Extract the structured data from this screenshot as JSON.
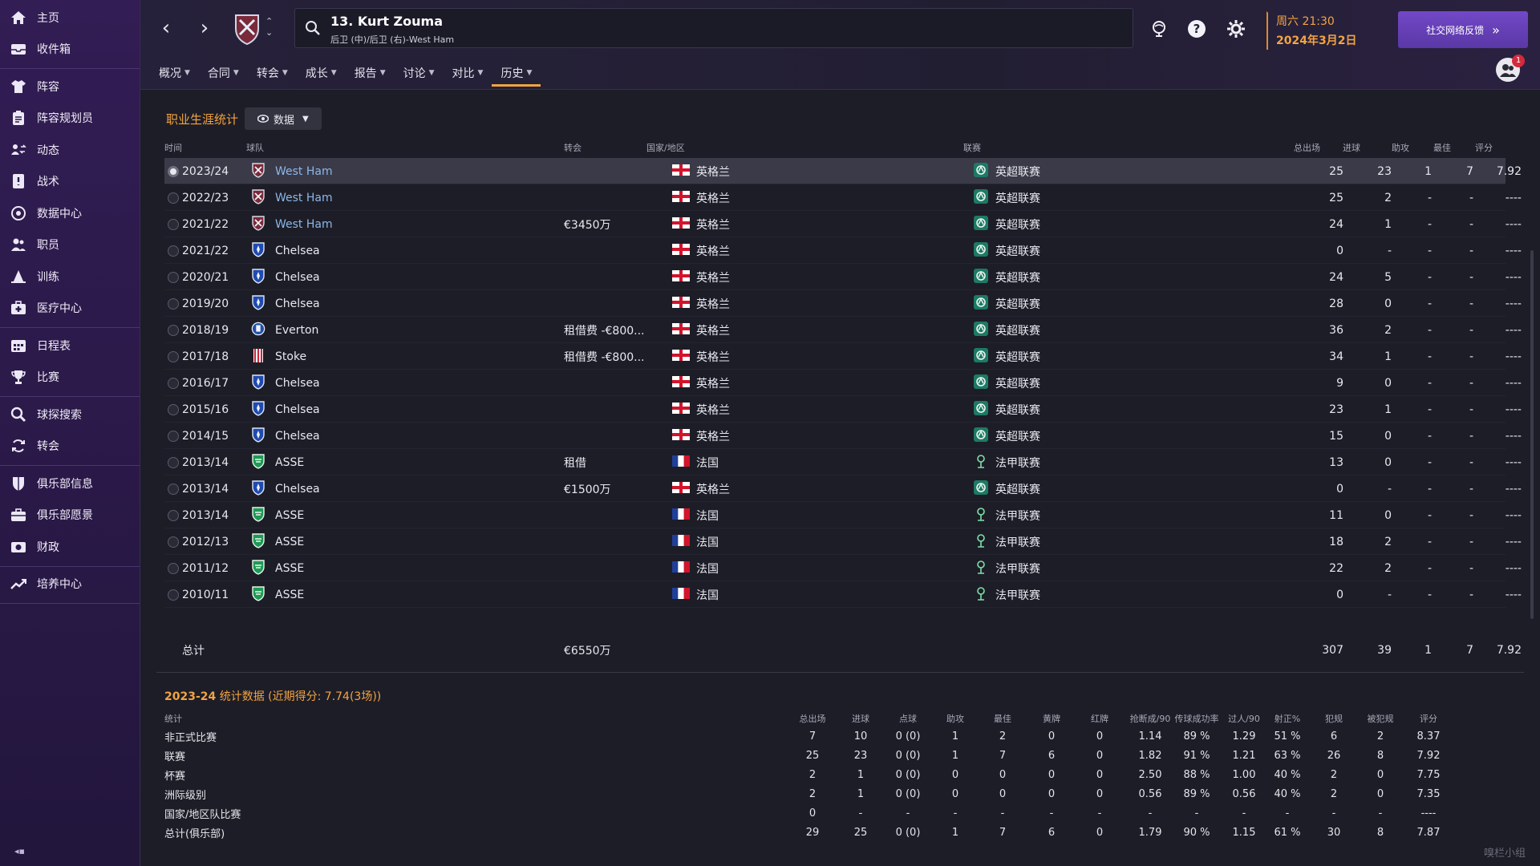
{
  "sidebar": {
    "groups": [
      [
        {
          "label": "主页",
          "icon": "home-icon"
        },
        {
          "label": "收件箱",
          "icon": "inbox-icon"
        }
      ],
      [
        {
          "label": "阵容",
          "icon": "shirt-icon"
        },
        {
          "label": "阵容规划员",
          "icon": "clipboard-icon"
        },
        {
          "label": "动态",
          "icon": "dynamics-icon"
        },
        {
          "label": "战术",
          "icon": "tactics-icon"
        },
        {
          "label": "数据中心",
          "icon": "data-hub-icon"
        },
        {
          "label": "职员",
          "icon": "staff-icon"
        },
        {
          "label": "训练",
          "icon": "training-icon"
        },
        {
          "label": "医疗中心",
          "icon": "medical-icon"
        }
      ],
      [
        {
          "label": "日程表",
          "icon": "calendar-icon"
        },
        {
          "label": "比赛",
          "icon": "trophy-icon"
        }
      ],
      [
        {
          "label": "球探搜索",
          "icon": "scout-search-icon"
        },
        {
          "label": "转会",
          "icon": "transfer-icon"
        }
      ],
      [
        {
          "label": "俱乐部信息",
          "icon": "club-shield-icon"
        },
        {
          "label": "俱乐部愿景",
          "icon": "briefcase-icon"
        },
        {
          "label": "财政",
          "icon": "finance-icon"
        }
      ],
      [
        {
          "label": "培养中心",
          "icon": "development-icon"
        }
      ]
    ]
  },
  "header": {
    "player_name": "13. Kurt Zouma",
    "player_position": "后卫 (中)/后卫 (右)-West Ham",
    "date_time": "周六 21:30",
    "date": "2024年3月2日",
    "feedback_label": "社交网络反馈",
    "notification_count": "1",
    "tabs": [
      {
        "label": "概况",
        "active": false
      },
      {
        "label": "合同",
        "active": false
      },
      {
        "label": "转会",
        "active": false
      },
      {
        "label": "成长",
        "active": false
      },
      {
        "label": "报告",
        "active": false
      },
      {
        "label": "讨论",
        "active": false
      },
      {
        "label": "对比",
        "active": false
      },
      {
        "label": "历史",
        "active": true
      }
    ]
  },
  "career": {
    "title": "职业生涯统计",
    "dropdown_label": "数据",
    "columns": {
      "season": "时间",
      "team": "球队",
      "transfer": "转会",
      "nation": "国家/地区",
      "league": "联赛",
      "apps": "总出场",
      "goals": "进球",
      "assists": "助攻",
      "pom": "最佳",
      "rating": "评分"
    },
    "rows": [
      {
        "season": "2023/24",
        "team": "West Ham",
        "club": "westham",
        "transfer": "",
        "nation": "英格兰",
        "flag": "eng",
        "league": "英超联赛",
        "lg": "epl",
        "apps": "25",
        "goals": "23",
        "assists": "1",
        "pom": "7",
        "rating": "7.92",
        "selected": true
      },
      {
        "season": "2022/23",
        "team": "West Ham",
        "club": "westham",
        "transfer": "",
        "nation": "英格兰",
        "flag": "eng",
        "league": "英超联赛",
        "lg": "epl",
        "apps": "25",
        "goals": "2",
        "assists": "-",
        "pom": "-",
        "rating": "----"
      },
      {
        "season": "2021/22",
        "team": "West Ham",
        "club": "westham",
        "transfer": "€3450万",
        "nation": "英格兰",
        "flag": "eng",
        "league": "英超联赛",
        "lg": "epl",
        "apps": "24",
        "goals": "1",
        "assists": "-",
        "pom": "-",
        "rating": "----"
      },
      {
        "season": "2021/22",
        "team": "Chelsea",
        "club": "chelsea",
        "transfer": "",
        "nation": "英格兰",
        "flag": "eng",
        "league": "英超联赛",
        "lg": "epl",
        "apps": "0",
        "goals": "-",
        "assists": "-",
        "pom": "-",
        "rating": "----"
      },
      {
        "season": "2020/21",
        "team": "Chelsea",
        "club": "chelsea",
        "transfer": "",
        "nation": "英格兰",
        "flag": "eng",
        "league": "英超联赛",
        "lg": "epl",
        "apps": "24",
        "goals": "5",
        "assists": "-",
        "pom": "-",
        "rating": "----"
      },
      {
        "season": "2019/20",
        "team": "Chelsea",
        "club": "chelsea",
        "transfer": "",
        "nation": "英格兰",
        "flag": "eng",
        "league": "英超联赛",
        "lg": "epl",
        "apps": "28",
        "goals": "0",
        "assists": "-",
        "pom": "-",
        "rating": "----"
      },
      {
        "season": "2018/19",
        "team": "Everton",
        "club": "everton",
        "transfer": "租借费 -€800...",
        "nation": "英格兰",
        "flag": "eng",
        "league": "英超联赛",
        "lg": "epl",
        "apps": "36",
        "goals": "2",
        "assists": "-",
        "pom": "-",
        "rating": "----"
      },
      {
        "season": "2017/18",
        "team": "Stoke",
        "club": "stoke",
        "transfer": "租借费 -€800...",
        "nation": "英格兰",
        "flag": "eng",
        "league": "英超联赛",
        "lg": "epl",
        "apps": "34",
        "goals": "1",
        "assists": "-",
        "pom": "-",
        "rating": "----"
      },
      {
        "season": "2016/17",
        "team": "Chelsea",
        "club": "chelsea",
        "transfer": "",
        "nation": "英格兰",
        "flag": "eng",
        "league": "英超联赛",
        "lg": "epl",
        "apps": "9",
        "goals": "0",
        "assists": "-",
        "pom": "-",
        "rating": "----"
      },
      {
        "season": "2015/16",
        "team": "Chelsea",
        "club": "chelsea",
        "transfer": "",
        "nation": "英格兰",
        "flag": "eng",
        "league": "英超联赛",
        "lg": "epl",
        "apps": "23",
        "goals": "1",
        "assists": "-",
        "pom": "-",
        "rating": "----"
      },
      {
        "season": "2014/15",
        "team": "Chelsea",
        "club": "chelsea",
        "transfer": "",
        "nation": "英格兰",
        "flag": "eng",
        "league": "英超联赛",
        "lg": "epl",
        "apps": "15",
        "goals": "0",
        "assists": "-",
        "pom": "-",
        "rating": "----"
      },
      {
        "season": "2013/14",
        "team": "ASSE",
        "club": "asse",
        "transfer": "租借",
        "nation": "法国",
        "flag": "fra",
        "league": "法甲联赛",
        "lg": "l1",
        "apps": "13",
        "goals": "0",
        "assists": "-",
        "pom": "-",
        "rating": "----"
      },
      {
        "season": "2013/14",
        "team": "Chelsea",
        "club": "chelsea",
        "transfer": "€1500万",
        "nation": "英格兰",
        "flag": "eng",
        "league": "英超联赛",
        "lg": "epl",
        "apps": "0",
        "goals": "-",
        "assists": "-",
        "pom": "-",
        "rating": "----"
      },
      {
        "season": "2013/14",
        "team": "ASSE",
        "club": "asse",
        "transfer": "",
        "nation": "法国",
        "flag": "fra",
        "league": "法甲联赛",
        "lg": "l1",
        "apps": "11",
        "goals": "0",
        "assists": "-",
        "pom": "-",
        "rating": "----"
      },
      {
        "season": "2012/13",
        "team": "ASSE",
        "club": "asse",
        "transfer": "",
        "nation": "法国",
        "flag": "fra",
        "league": "法甲联赛",
        "lg": "l1",
        "apps": "18",
        "goals": "2",
        "assists": "-",
        "pom": "-",
        "rating": "----"
      },
      {
        "season": "2011/12",
        "team": "ASSE",
        "club": "asse",
        "transfer": "",
        "nation": "法国",
        "flag": "fra",
        "league": "法甲联赛",
        "lg": "l1",
        "apps": "22",
        "goals": "2",
        "assists": "-",
        "pom": "-",
        "rating": "----"
      },
      {
        "season": "2010/11",
        "team": "ASSE",
        "club": "asse",
        "transfer": "",
        "nation": "法国",
        "flag": "fra",
        "league": "法甲联赛",
        "lg": "l1",
        "apps": "0",
        "goals": "-",
        "assists": "-",
        "pom": "-",
        "rating": "----"
      }
    ],
    "total": {
      "label": "总计",
      "transfer": "€6550万",
      "apps": "307",
      "goals": "39",
      "assists": "1",
      "pom": "7",
      "rating": "7.92"
    }
  },
  "season_stats": {
    "title_year": "2023-24",
    "title_rest": " 统计数据 (近期得分: 7.74(3场))",
    "label_header": "统计",
    "columns": [
      "总出场",
      "进球",
      "点球",
      "助攻",
      "最佳",
      "黄牌",
      "红牌",
      "抢断成/90",
      "传球成功率",
      "过人/90",
      "射正%",
      "犯规",
      "被犯规",
      "评分"
    ],
    "rows": [
      {
        "label": "非正式比赛",
        "values": [
          "7",
          "10",
          "0 (0)",
          "1",
          "2",
          "0",
          "0",
          "1.14",
          "89 %",
          "1.29",
          "51 %",
          "6",
          "2",
          "8.37"
        ]
      },
      {
        "label": "联赛",
        "values": [
          "25",
          "23",
          "0 (0)",
          "1",
          "7",
          "6",
          "0",
          "1.82",
          "91 %",
          "1.21",
          "63 %",
          "26",
          "8",
          "7.92"
        ]
      },
      {
        "label": "杯赛",
        "values": [
          "2",
          "1",
          "0 (0)",
          "0",
          "0",
          "0",
          "0",
          "2.50",
          "88 %",
          "1.00",
          "40 %",
          "2",
          "0",
          "7.75"
        ]
      },
      {
        "label": "洲际级别",
        "values": [
          "2",
          "1",
          "0 (0)",
          "0",
          "0",
          "0",
          "0",
          "0.56",
          "89 %",
          "0.56",
          "40 %",
          "2",
          "0",
          "7.35"
        ]
      },
      {
        "label": "国家/地区队比赛",
        "values": [
          "0",
          "-",
          "-",
          "-",
          "-",
          "-",
          "-",
          "-",
          "-",
          "-",
          "-",
          "-",
          "-",
          "----"
        ]
      },
      {
        "label": "总计(俱乐部)",
        "values": [
          "29",
          "25",
          "0 (0)",
          "1",
          "7",
          "6",
          "0",
          "1.79",
          "90 %",
          "1.15",
          "61 %",
          "30",
          "8",
          "7.87"
        ]
      }
    ]
  },
  "watermark": "嗅栏小组",
  "colors": {
    "accent_orange": "#f2a440",
    "link_blue": "#8cb7e8",
    "sidebar_purple": "#2a1948",
    "button_purple": "#6a42b8"
  }
}
